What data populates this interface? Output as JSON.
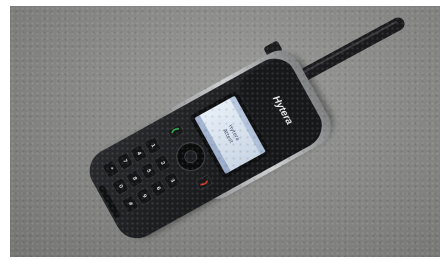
{
  "photo": {
    "subject_icon": "handheld-radio",
    "colors": {
      "background_surface": "#868684",
      "radio_body": "#1a1b1d",
      "bezel_silver": "#b8b9bb",
      "screen": "#d7e2ee",
      "call_key_green": "#2bb04a",
      "end_key_red": "#d23a2a"
    },
    "radio": {
      "brand_logo_text": "Hytera",
      "screen_lines": [
        "Hytera",
        "Attest"
      ],
      "keypad_keys": [
        "1",
        "2",
        "3",
        "4",
        "5",
        "6",
        "7",
        "8",
        "9",
        "*",
        "0",
        "#"
      ]
    }
  }
}
